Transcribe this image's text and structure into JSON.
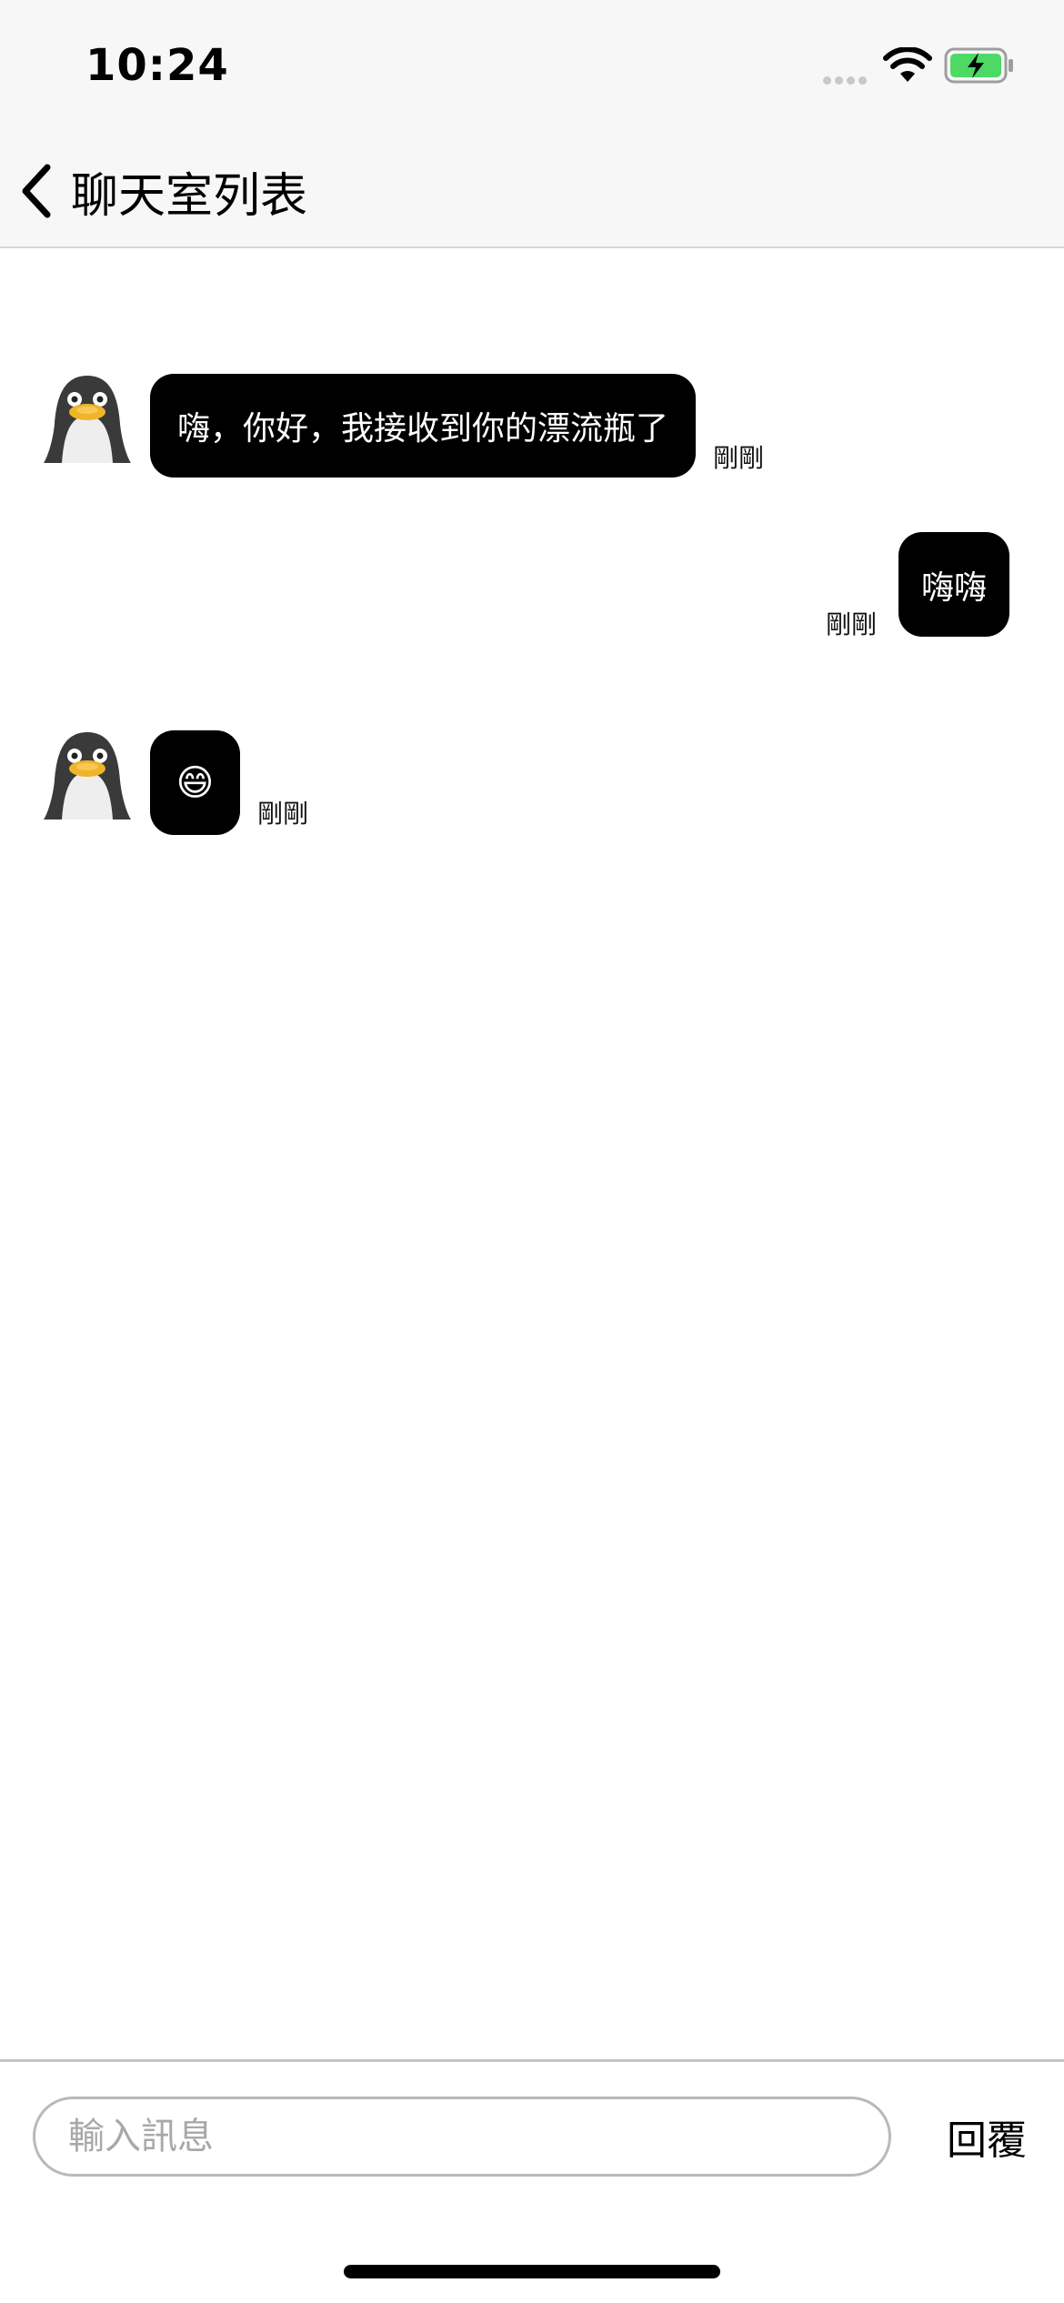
{
  "status_bar": {
    "time": "10:24"
  },
  "nav": {
    "back_title": "聊天室列表"
  },
  "messages": [
    {
      "side": "incoming",
      "text": "嗨，你好，我接收到你的漂流瓶了",
      "time": "剛剛"
    },
    {
      "side": "outgoing",
      "text": "嗨嗨",
      "time": "剛剛"
    },
    {
      "side": "incoming",
      "text": "😄",
      "time": "剛剛"
    }
  ],
  "input": {
    "placeholder": "輸入訊息",
    "value": ""
  },
  "reply_button": {
    "label": "回覆"
  }
}
